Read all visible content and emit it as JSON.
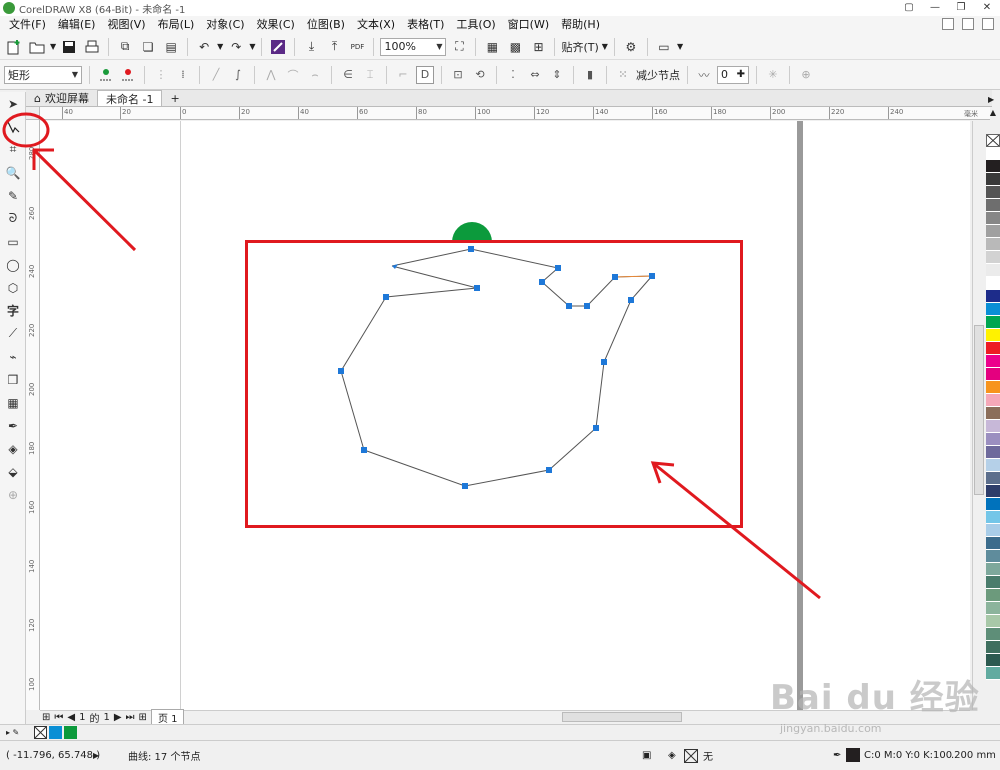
{
  "window": {
    "title": "CorelDRAW X8 (64-Bit) - 未命名 -1"
  },
  "menu": [
    "文件(F)",
    "编辑(E)",
    "视图(V)",
    "布局(L)",
    "对象(C)",
    "效果(C)",
    "位图(B)",
    "文本(X)",
    "表格(T)",
    "工具(O)",
    "窗口(W)",
    "帮助(H)"
  ],
  "toolbar": {
    "zoom": "100%",
    "snap_label": "贴齐(T)",
    "pdf_label": "PDF"
  },
  "propertybar": {
    "shape_type": "矩形",
    "reduce_nodes": "减少节点",
    "smooth_value": "0"
  },
  "tabs": {
    "welcome": "欢迎屏幕",
    "document": "未命名 -1",
    "add": "+"
  },
  "ruler": {
    "h": [
      [
        "40",
        62
      ],
      [
        "20",
        120
      ],
      [
        "0",
        180
      ],
      [
        "20",
        239
      ],
      [
        "40",
        298
      ],
      [
        "60",
        357
      ],
      [
        "80",
        416
      ],
      [
        "100",
        475
      ],
      [
        "120",
        534
      ],
      [
        "140",
        593
      ],
      [
        "160",
        652
      ],
      [
        "180",
        711
      ],
      [
        "200",
        770
      ],
      [
        "220",
        829
      ],
      [
        "240",
        888
      ]
    ],
    "unit": "毫米",
    "v": [
      [
        "280",
        160
      ],
      [
        "260",
        220
      ],
      [
        "240",
        278
      ],
      [
        "220",
        337
      ],
      [
        "200",
        396
      ],
      [
        "180",
        455
      ],
      [
        "160",
        514
      ],
      [
        "140",
        573
      ],
      [
        "120",
        632
      ],
      [
        "100",
        691
      ]
    ]
  },
  "pagenav": {
    "current": "1",
    "sep": "的",
    "total": "1",
    "page_tab": "页 1"
  },
  "status": {
    "coords": "( -11.796, 65.748 )",
    "curve_info": "曲线: 17 个节点",
    "fill_none": "无",
    "color_info": "C:0 M:0 Y:0 K:100",
    "outline_width": ".200 mm"
  },
  "palette": [
    "#ffffff",
    "#231f20",
    "#3a3a3a",
    "#555555",
    "#6e6e6e",
    "#878787",
    "#a0a0a0",
    "#b9b9b9",
    "#d2d2d2",
    "#ebebeb",
    "#ffffff",
    "#1d2c8a",
    "#0a8fd5",
    "#00a650",
    "#fff200",
    "#ed1c24",
    "#ec008c",
    "#e4007f",
    "#f7941d",
    "#f5a8b8",
    "#8b6e5a",
    "#c7b8d8",
    "#9b8fc0",
    "#6e6a9c",
    "#b5d0e8",
    "#5c6e8c",
    "#2e3d6a",
    "#0072bc",
    "#74c6e8",
    "#a9cde8",
    "#3c6c8c",
    "#5f8c9c",
    "#7ea89c",
    "#4a7c6c",
    "#6c9a7c",
    "#8cb49c",
    "#a8c8a8",
    "#5e8e78",
    "#3f6f5f",
    "#2c5a50",
    "#61aba0"
  ],
  "watermark": {
    "main": "Bai du 经验",
    "sub": "jingyan.baidu.com"
  },
  "colors": {
    "accent": "#e0191f",
    "path_stroke": "#555555",
    "node": "#1e78d8",
    "green_shape": "#0c9a3c"
  }
}
